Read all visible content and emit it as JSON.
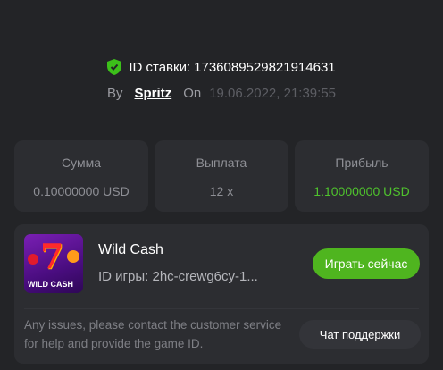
{
  "bet": {
    "id_label": "ID ставки:",
    "id_value": "173608952982191463​1",
    "by_label": "By",
    "username": "Spritz",
    "on_label": "On",
    "datetime": "19.06.2022, 21:39:55"
  },
  "stats": [
    {
      "label": "Сумма",
      "value": "0.10000000 USD"
    },
    {
      "label": "Выплата",
      "value": "12 x"
    },
    {
      "label": "Прибыль",
      "value": "1.10000000 USD"
    }
  ],
  "game": {
    "thumbnail_text": "WILD CASH",
    "title": "Wild Cash",
    "id_text": "ID игры: 2hc-crewg6cy-1...",
    "play_label": "Играть сейчас",
    "help_text": "Any issues, please contact the customer service for help and provide the game ID.",
    "support_label": "Чат поддержки"
  },
  "colors": {
    "background": "#232427",
    "card": "#2c2d31",
    "accent_green": "#4fb51f",
    "profit_green": "#4fc22d"
  }
}
